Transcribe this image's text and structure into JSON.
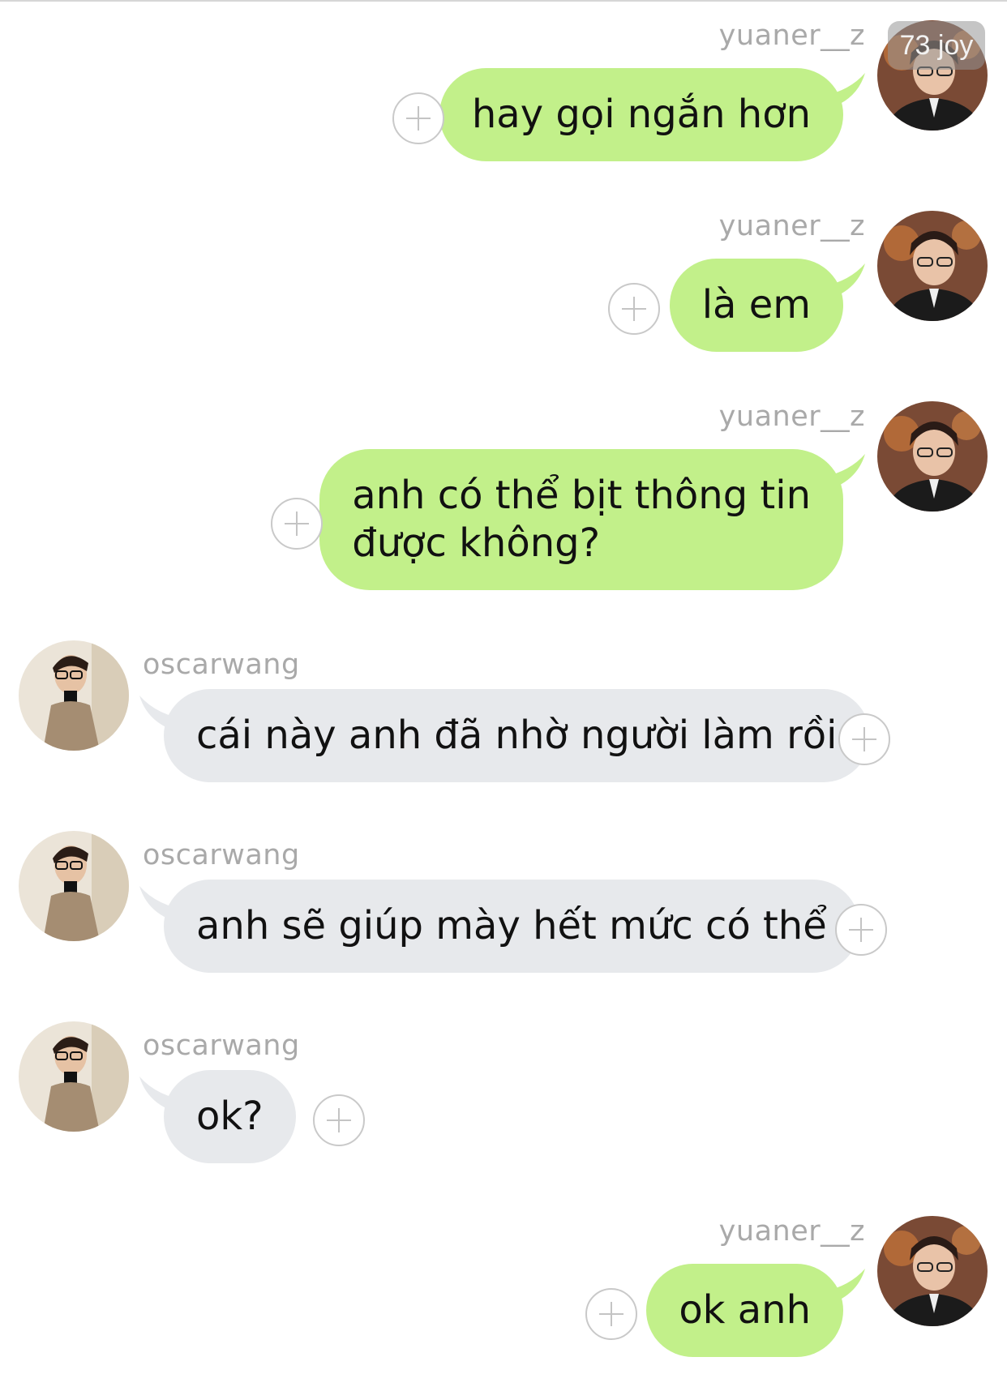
{
  "chat": {
    "messages": [
      {
        "sender": "yuaner__z",
        "direction": "out",
        "lines": [
          "hay gọi ngắn hơn"
        ]
      },
      {
        "sender": "yuaner__z",
        "direction": "out",
        "lines": [
          "là em"
        ]
      },
      {
        "sender": "yuaner__z",
        "direction": "out",
        "lines": [
          "anh có thể bịt thông tin",
          "được không?"
        ]
      },
      {
        "sender": "oscarwang",
        "direction": "in",
        "lines": [
          "cái này anh đã nhờ người làm rồi"
        ]
      },
      {
        "sender": "oscarwang",
        "direction": "in",
        "lines": [
          "anh sẽ giúp mày hết mức có thể"
        ]
      },
      {
        "sender": "oscarwang",
        "direction": "in",
        "lines": [
          "ok?"
        ]
      },
      {
        "sender": "yuaner__z",
        "direction": "out",
        "lines": [
          "ok anh"
        ]
      }
    ]
  },
  "watermark": "73 joy",
  "colors": {
    "outgoing_bubble": "#c2f08a",
    "incoming_bubble": "#e7e9ec",
    "username": "#a9a9a9",
    "add_icon": "#c4c4c4"
  },
  "icons": {
    "add": "plus-circle-icon",
    "avatar_out": "avatar-yuaner",
    "avatar_in": "avatar-oscarwang"
  }
}
